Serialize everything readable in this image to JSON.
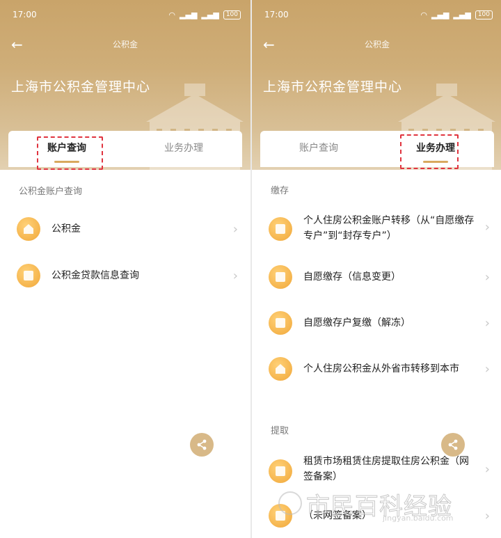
{
  "left": {
    "status": {
      "time": "17:00",
      "battery": "100"
    },
    "nav": {
      "title": "公积金"
    },
    "org_title": "上海市公积金管理中心",
    "tabs": [
      {
        "label": "账户查询",
        "active": true
      },
      {
        "label": "业务办理",
        "active": false
      }
    ],
    "section": "公积金账户查询",
    "items": [
      {
        "label": "公积金",
        "icon": "house-icon"
      },
      {
        "label": "公积金贷款信息查询",
        "icon": "document-check-icon"
      }
    ]
  },
  "right": {
    "status": {
      "time": "17:00",
      "battery": "100"
    },
    "nav": {
      "title": "公积金"
    },
    "org_title": "上海市公积金管理中心",
    "tabs": [
      {
        "label": "账户查询",
        "active": false
      },
      {
        "label": "业务办理",
        "active": true
      }
    ],
    "section_deposit": "缴存",
    "deposit_items": [
      {
        "label": "个人住房公积金账户转移（从“自愿缴存专户”到“封存专户”）",
        "icon": "document-icon"
      },
      {
        "label": "自愿缴存（信息变更）",
        "icon": "edit-icon"
      },
      {
        "label": "自愿缴存户复缴（解冻）",
        "icon": "unlock-icon"
      },
      {
        "label": "个人住房公积金从外省市转移到本市",
        "icon": "house-icon"
      }
    ],
    "section_withdraw": "提取",
    "withdraw_items": [
      {
        "label": "租赁市场租赁住房提取住房公积金（网签备案）",
        "icon": "document-icon"
      },
      {
        "label": "（未网签备案）",
        "icon": "document-icon"
      }
    ]
  },
  "watermark": {
    "text": "市民百科经验",
    "url": "jingyan.baidu.com"
  },
  "colors": {
    "header": "#c9a46a",
    "accent": "#d8a95e",
    "icon": "#f5b44c",
    "highlight": "#e0343f"
  }
}
